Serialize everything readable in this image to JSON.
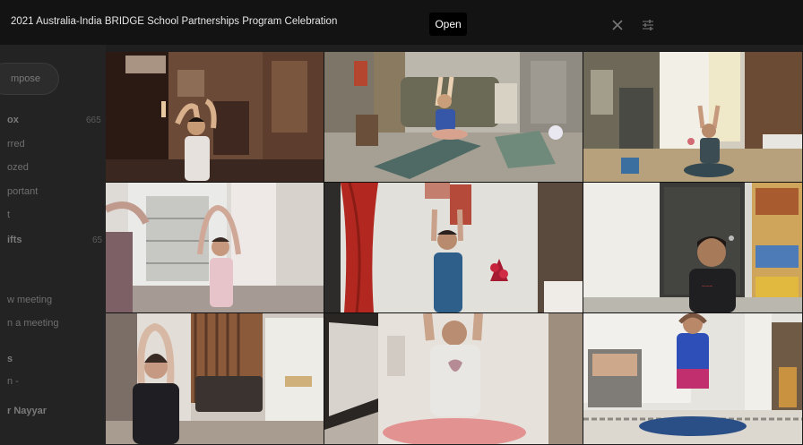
{
  "window": {
    "title": "2021 Australia-India BRIDGE School Partnerships Program Celebration",
    "open_label": "Open"
  },
  "sidebar": {
    "compose": "mpose",
    "items": [
      {
        "label": "ox",
        "count": "665",
        "bold": true
      },
      {
        "label": "rred",
        "count": "",
        "bold": false
      },
      {
        "label": "ozed",
        "count": "",
        "bold": false
      },
      {
        "label": "portant",
        "count": "",
        "bold": false
      },
      {
        "label": "t",
        "count": "",
        "bold": false
      },
      {
        "label": "ifts",
        "count": "65",
        "bold": true
      },
      {
        "label": "w meeting",
        "count": "",
        "bold": false
      },
      {
        "label": "n a meeting",
        "count": "",
        "bold": false
      },
      {
        "label": "s",
        "count": "",
        "bold": true
      },
      {
        "label": "n -",
        "count": "",
        "bold": false
      },
      {
        "label": "r Nayyar",
        "count": "",
        "bold": true
      }
    ]
  },
  "video_grid": {
    "tiles": [
      {
        "scene": "child-in-living-room-arms-raised"
      },
      {
        "scene": "child-on-yoga-mat-sofa-background"
      },
      {
        "scene": "child-seated-cluttered-room"
      },
      {
        "scene": "two-people-arms-raised-by-window"
      },
      {
        "scene": "woman-arms-raised-red-curtain"
      },
      {
        "scene": "boy-seated-near-door"
      },
      {
        "scene": "girl-hands-on-head-room"
      },
      {
        "scene": "child-arms-raised-cross-legged"
      },
      {
        "scene": "girl-hands-on-head-seated"
      }
    ]
  }
}
